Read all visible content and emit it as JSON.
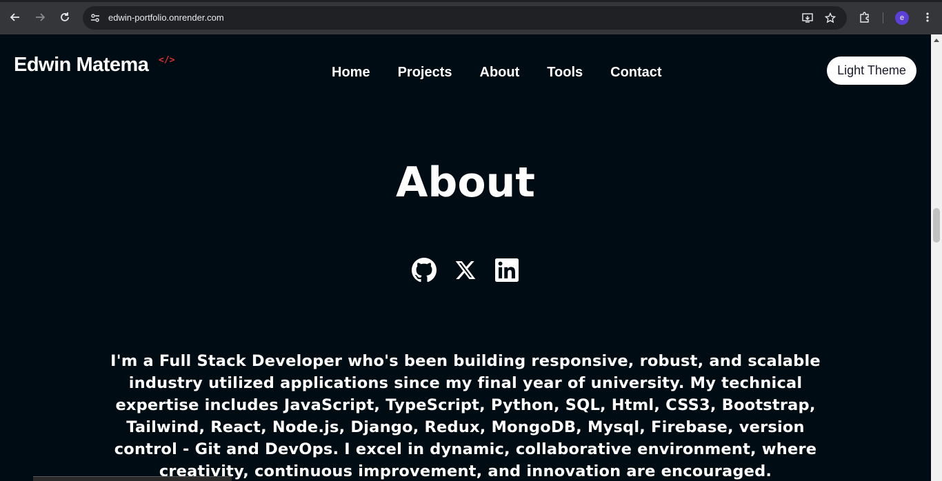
{
  "browser": {
    "url": "edwin-portfolio.onrender.com",
    "profile_initial": "e",
    "icons": [
      "back-icon",
      "forward-icon",
      "reload-icon",
      "site-info-icon",
      "install-app-icon",
      "bookmark-star-icon",
      "extensions-icon",
      "more-menu-icon"
    ]
  },
  "header": {
    "logo": "Edwin Matema",
    "logo_mark": "</>",
    "nav": [
      "Home",
      "Projects",
      "About",
      "Tools",
      "Contact"
    ],
    "theme_button": "Light Theme"
  },
  "about": {
    "title": "About",
    "socials": [
      "github-icon",
      "x-icon",
      "linkedin-icon"
    ],
    "bio": "I'm a Full Stack Developer who's been building responsive, robust, and scalable industry utilized applications since my final year of university. My technical expertise includes JavaScript, TypeScript, Python, SQL, Html, CSS3, Bootstrap, Tailwind, React, Node.js, Django, Redux, MongoDB, Mysql, Firebase, version control - Git and DevOps. I excel in dynamic, collaborative environment, where creativity, continuous improvement, and innovation are encouraged."
  },
  "colors": {
    "page_background": "#000c14",
    "accent": "#e03131",
    "chrome": "#35363a"
  }
}
